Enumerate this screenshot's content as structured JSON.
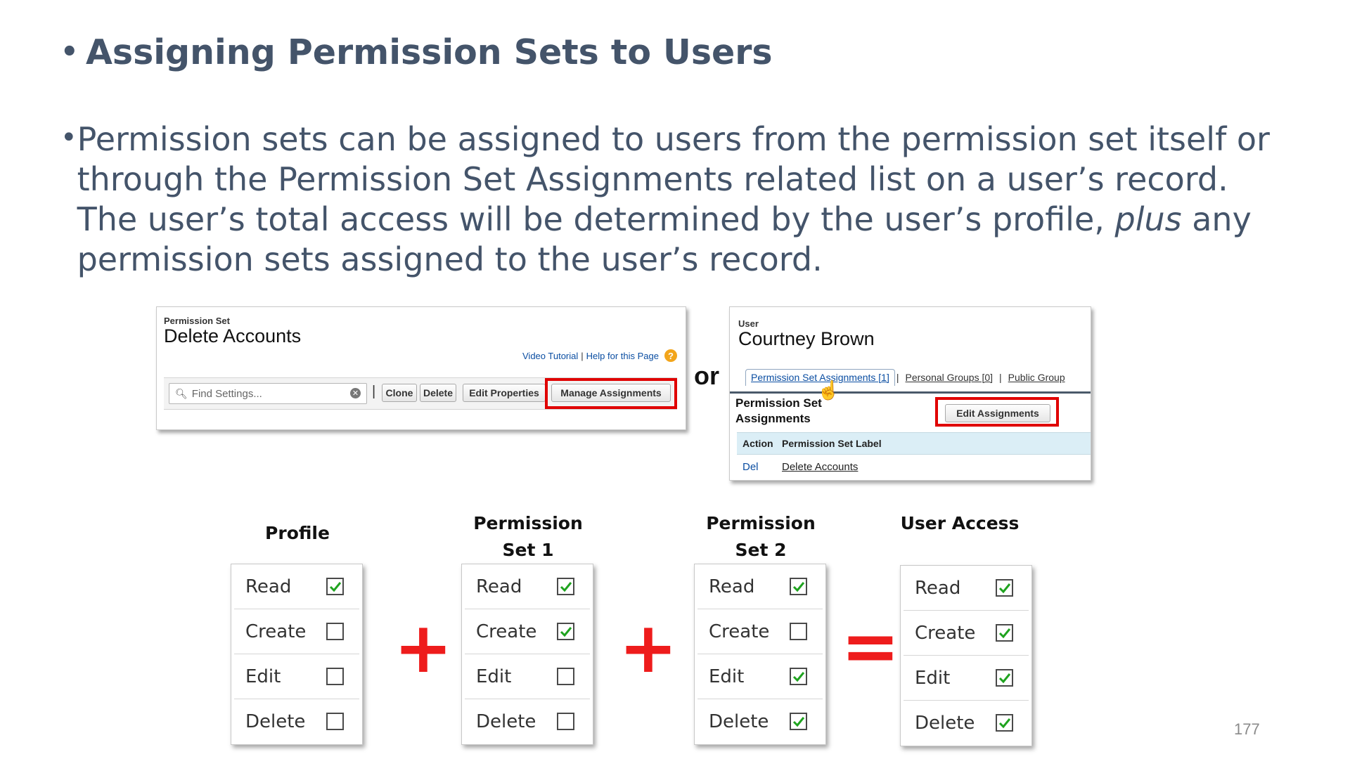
{
  "slide": {
    "title": "Assigning Permission Sets to Users",
    "body_part1": "Permission sets can be assigned to users from the permission set itself or through the Permission Set Assignments related list on a user’s record. The user’s total access will be determined by the user’s profile, ",
    "body_emph": "plus",
    "body_part2": " any permission sets assigned to the user’s record.",
    "or_text": "or",
    "page_number": "177"
  },
  "permission_set_screen": {
    "kicker": "Permission Set",
    "name": "Delete Accounts",
    "video_tutorial": "Video Tutorial",
    "help_link": "Help for this Page",
    "help_sep": "|",
    "help_icon_glyph": "?",
    "search_placeholder": "Find Settings...",
    "toolbar_sep": "|",
    "buttons": [
      "Clone",
      "Delete",
      "Edit Properties",
      "Manage Assignments"
    ]
  },
  "user_screen": {
    "kicker": "User",
    "name": "Courtney Brown",
    "tabs": [
      "Permission Set Assignments [1]",
      "Personal Groups [0]",
      "Public Group"
    ],
    "tab_sep": "|",
    "related_list_title": "Permission Set Assignments",
    "edit_button": "Edit Assignments",
    "table_headers": [
      "Action",
      "Permission Set Label"
    ],
    "rows": [
      {
        "action": "Del",
        "label": "Delete Accounts"
      }
    ]
  },
  "access_columns": [
    {
      "title": "Profile",
      "rows": [
        {
          "label": "Read",
          "checked": true
        },
        {
          "label": "Create",
          "checked": false
        },
        {
          "label": "Edit",
          "checked": false
        },
        {
          "label": "Delete",
          "checked": false
        }
      ]
    },
    {
      "title": "Permission Set 1",
      "rows": [
        {
          "label": "Read",
          "checked": true
        },
        {
          "label": "Create",
          "checked": true
        },
        {
          "label": "Edit",
          "checked": false
        },
        {
          "label": "Delete",
          "checked": false
        }
      ]
    },
    {
      "title": "Permission Set 2",
      "rows": [
        {
          "label": "Read",
          "checked": true
        },
        {
          "label": "Create",
          "checked": false
        },
        {
          "label": "Edit",
          "checked": true
        },
        {
          "label": "Delete",
          "checked": true
        }
      ]
    },
    {
      "title": "User Access",
      "rows": [
        {
          "label": "Read",
          "checked": true
        },
        {
          "label": "Create",
          "checked": true
        },
        {
          "label": "Edit",
          "checked": true
        },
        {
          "label": "Delete",
          "checked": true
        }
      ]
    }
  ],
  "operators": [
    "+",
    "+",
    "="
  ],
  "colors": {
    "title_text": "#44546a",
    "highlight_red": "#e00000",
    "operator_red": "#ee1c1c",
    "check_green": "#1fa31f"
  }
}
